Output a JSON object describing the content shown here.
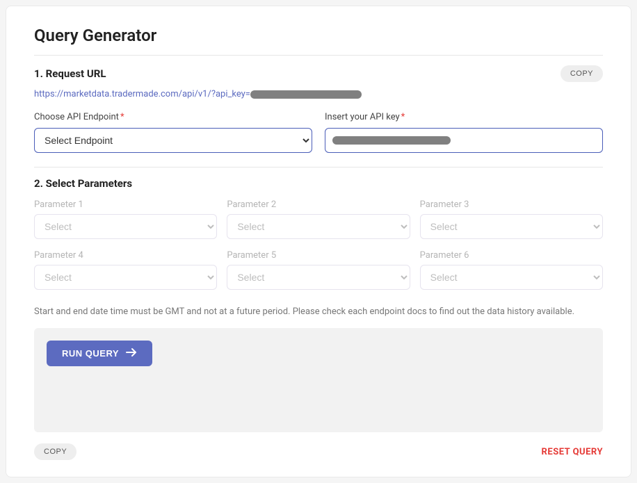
{
  "title": "Query Generator",
  "section1": {
    "title": "1. Request URL",
    "copy_label": "COPY",
    "url_visible": "https://marketdata.tradermade.com/api/v1/?api_key=",
    "endpoint_label": "Choose API Endpoint",
    "endpoint_placeholder": "Select Endpoint",
    "apikey_label": "Insert your API key"
  },
  "section2": {
    "title": "2. Select Parameters",
    "parameters": [
      {
        "label": "Parameter 1",
        "placeholder": "Select"
      },
      {
        "label": "Parameter 2",
        "placeholder": "Select"
      },
      {
        "label": "Parameter 3",
        "placeholder": "Select"
      },
      {
        "label": "Parameter 4",
        "placeholder": "Select"
      },
      {
        "label": "Parameter 5",
        "placeholder": "Select"
      },
      {
        "label": "Parameter 6",
        "placeholder": "Select"
      }
    ],
    "note": "Start and end date time must be GMT and not at a future period. Please check each endpoint docs to find out the data history available."
  },
  "actions": {
    "run_label": "RUN QUERY",
    "copy_label": "COPY",
    "reset_label": "RESET QUERY"
  }
}
